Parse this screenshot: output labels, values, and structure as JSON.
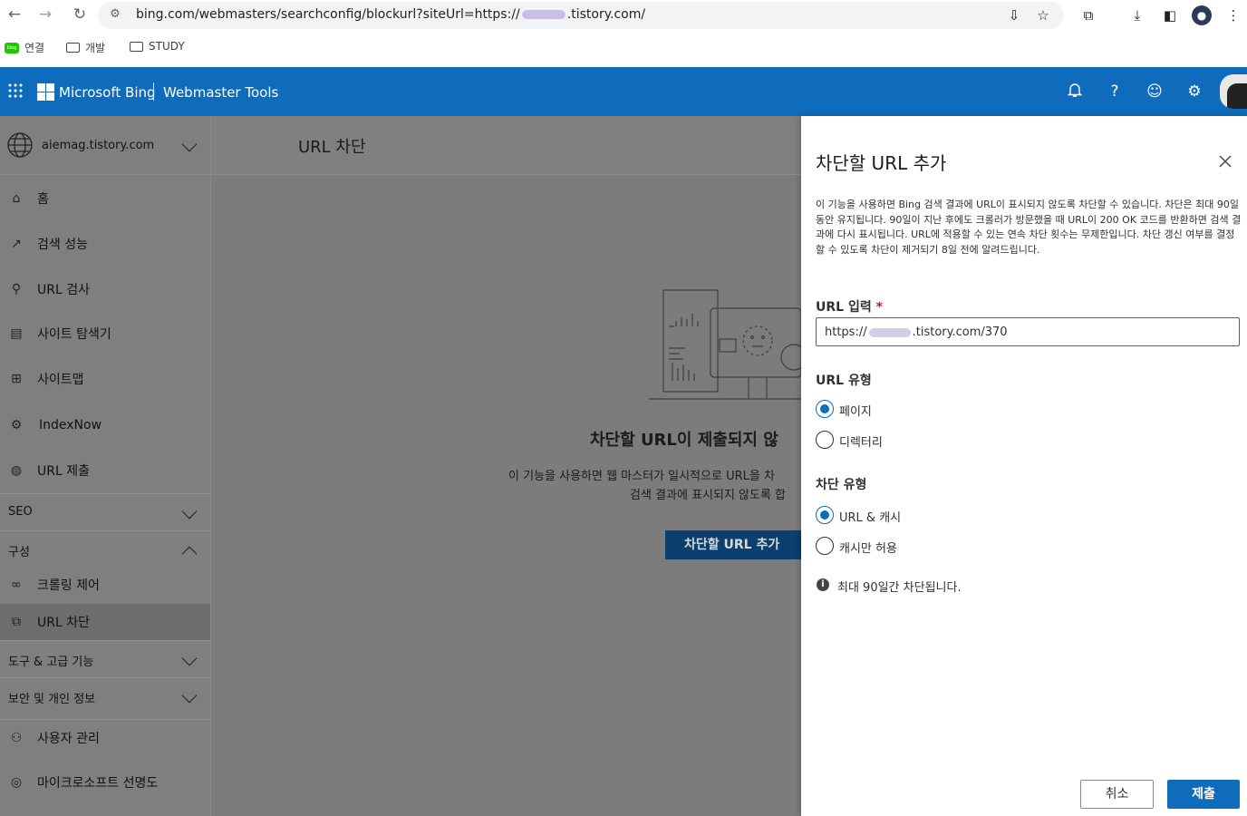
{
  "browser": {
    "url_prefix": "bing.com/webmasters/searchconfig/blockurl?siteUrl=https://",
    "url_suffix": ".tistory.com/",
    "bookmarks": [
      "연결",
      "개발",
      "STUDY"
    ],
    "bookmark_badge": "blog"
  },
  "header": {
    "brand": "Microsoft Bing",
    "product": "Webmaster Tools"
  },
  "sidebar": {
    "site": "aiemag.tistory.com",
    "items": [
      {
        "label": "홈",
        "icon": "home-icon"
      },
      {
        "label": "검색 성능",
        "icon": "trend-icon"
      },
      {
        "label": "URL 검사",
        "icon": "search-icon"
      },
      {
        "label": "사이트 탐색기",
        "icon": "document-icon"
      },
      {
        "label": "사이트맵",
        "icon": "sitemap-icon"
      },
      {
        "label": "IndexNow",
        "icon": "gear-icon"
      },
      {
        "label": "URL 제출",
        "icon": "globe-icon"
      }
    ],
    "sections": {
      "seo": "SEO",
      "config": "구성",
      "tools": "도구 & 고급 기능",
      "security": "보안 및 개인 정보"
    },
    "config_items": {
      "crawl": "크롤링 제어",
      "block": "URL 차단"
    },
    "bottom_items": {
      "users": "사용자 관리",
      "reputation": "마이크로소프트 선명도"
    }
  },
  "main": {
    "title": "URL 차단",
    "empty_title": "차단할 URL이 제출되지 않",
    "empty_line1": "이 기능을 사용하면 웹 마스터가 일시적으로 URL을 차",
    "empty_line2": "검색 결과에 표시되지 않도록 합",
    "add_button": "차단할 URL 추가"
  },
  "panel": {
    "title": "차단할 URL 추가",
    "description": "이 기능을 사용하면 Bing 검색 결과에 URL이 표시되지 않도록 차단할 수 있습니다. 차단은 최대 90일 동안 유지됩니다. 90일이 지난 후에도 크롤러가 방문했을 때 URL이 200 OK 코드를 반환하면 검색 결과에 다시 표시됩니다. URL에 적용할 수 있는 연속 차단 횟수는 무제한입니다. 차단 갱신 여부를 결정할 수 있도록 차단이 제거되기 8일 전에 알려드립니다.",
    "url_label": "URL 입력",
    "required_mark": "*",
    "url_prefix": "https://",
    "url_suffix": ".tistory.com/370",
    "url_type_label": "URL 유형",
    "url_type_options": [
      {
        "label": "페이지",
        "selected": true
      },
      {
        "label": "디렉터리",
        "selected": false
      }
    ],
    "block_type_label": "차단 유형",
    "block_type_options": [
      {
        "label": "URL & 캐시",
        "selected": true
      },
      {
        "label": "캐시만 허용",
        "selected": false
      }
    ],
    "info_text": "최대 90일간 차단됩니다.",
    "cancel": "취소",
    "submit": "제출"
  },
  "colors": {
    "accent": "#0f6cbd",
    "overlay": "#7f7f7f"
  }
}
